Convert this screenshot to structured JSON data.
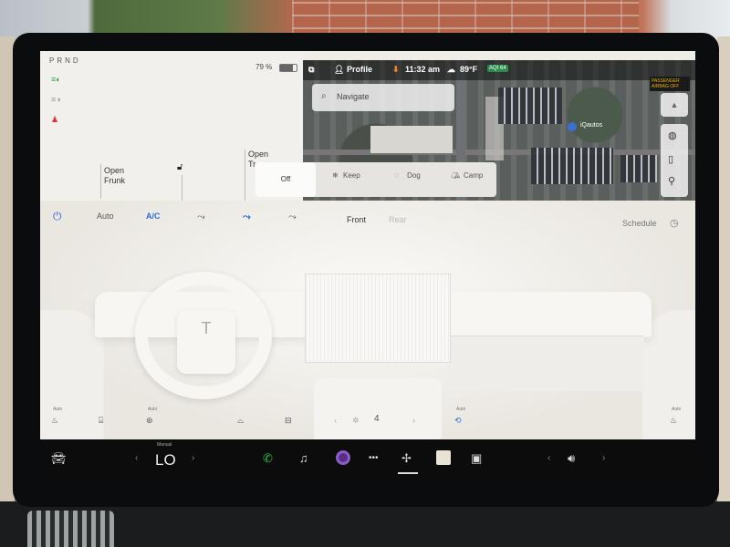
{
  "status": {
    "gear": "PRND",
    "battery_percent": "79 %",
    "battery_level": 0.79,
    "icons": [
      "headlights-icon",
      "auto-lights-icon",
      "seatbelt-warning-icon"
    ]
  },
  "car_status": {
    "frunk": "Open\nFrunk",
    "trunk": "Open\nTr"
  },
  "map_header": {
    "profile": "Profile",
    "time": "11:32 am",
    "temperature": "89°F",
    "aqi": "AQI 64",
    "airbag": "PASSENGER AIRBAG OFF"
  },
  "search": {
    "placeholder": "Navigate"
  },
  "map": {
    "poi_label": "iQautos"
  },
  "modes": {
    "off": "Off",
    "keep": "Keep",
    "dog": "Dog",
    "camp": "Camp"
  },
  "climate": {
    "auto": "Auto",
    "ac": "A/C",
    "front": "Front",
    "rear": "Rear",
    "schedule": "Schedule",
    "auto_small": "Auto",
    "fan_speed": "4"
  },
  "taskbar": {
    "mode": "Manual",
    "temp": "LO"
  },
  "colors": {
    "accent": "#2c6bd8",
    "phone": "#29c24a"
  }
}
